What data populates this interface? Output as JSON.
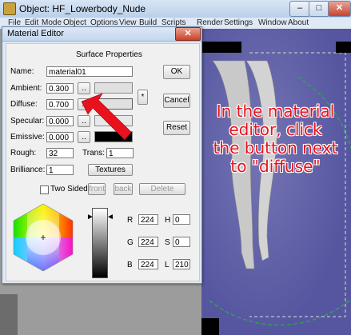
{
  "window": {
    "title": "Object: HF_Lowerbody_Nude",
    "min_glyph": "–",
    "max_glyph": "□",
    "close_glyph": "✕",
    "menu": [
      "File",
      "Edit",
      "Mode",
      "Object",
      "Options",
      "View",
      "Build",
      "Scripts",
      "Render",
      "Settings",
      "Window",
      "About"
    ]
  },
  "editor": {
    "title": "Material Editor",
    "close_glyph": "✕",
    "section_title": "Surface Properties",
    "name_label": "Name:",
    "name_value": "material01",
    "ambient_label": "Ambient:",
    "ambient_value": "0.300",
    "diffuse_label": "Diffuse:",
    "diffuse_value": "0.700",
    "specular_label": "Specular:",
    "specular_value": "0.000",
    "emissive_label": "Emissive:",
    "emissive_value": "0.000",
    "pick_button_label": "..",
    "star_label": "*",
    "rough_label": "Rough:",
    "rough_value": "32",
    "trans_label": "Trans:",
    "trans_value": "1",
    "brilliance_label": "Brilliance:",
    "brilliance_value": "1",
    "textures_label": "Textures",
    "ok_label": "OK",
    "cancel_label": "Cancel",
    "reset_label": "Reset",
    "two_sided_label": "Two Sided",
    "front_label": "front",
    "back_label": "back",
    "delete_label": "Delete",
    "r_label": "R",
    "r_value": "224",
    "g_label": "G",
    "g_value": "224",
    "b_label": "B",
    "b_value": "224",
    "h_label": "H",
    "h_value": "0",
    "s_label": "S",
    "s_value": "0",
    "l_label": "L",
    "l_value": "210"
  },
  "colors": {
    "diffuse_swatch": "#e0e0e0",
    "emissive_swatch": "#000000",
    "annotation": "#e8121e"
  },
  "annotation": {
    "text": "In the material\neditor, click\nthe button next\nto \"diffuse\""
  }
}
